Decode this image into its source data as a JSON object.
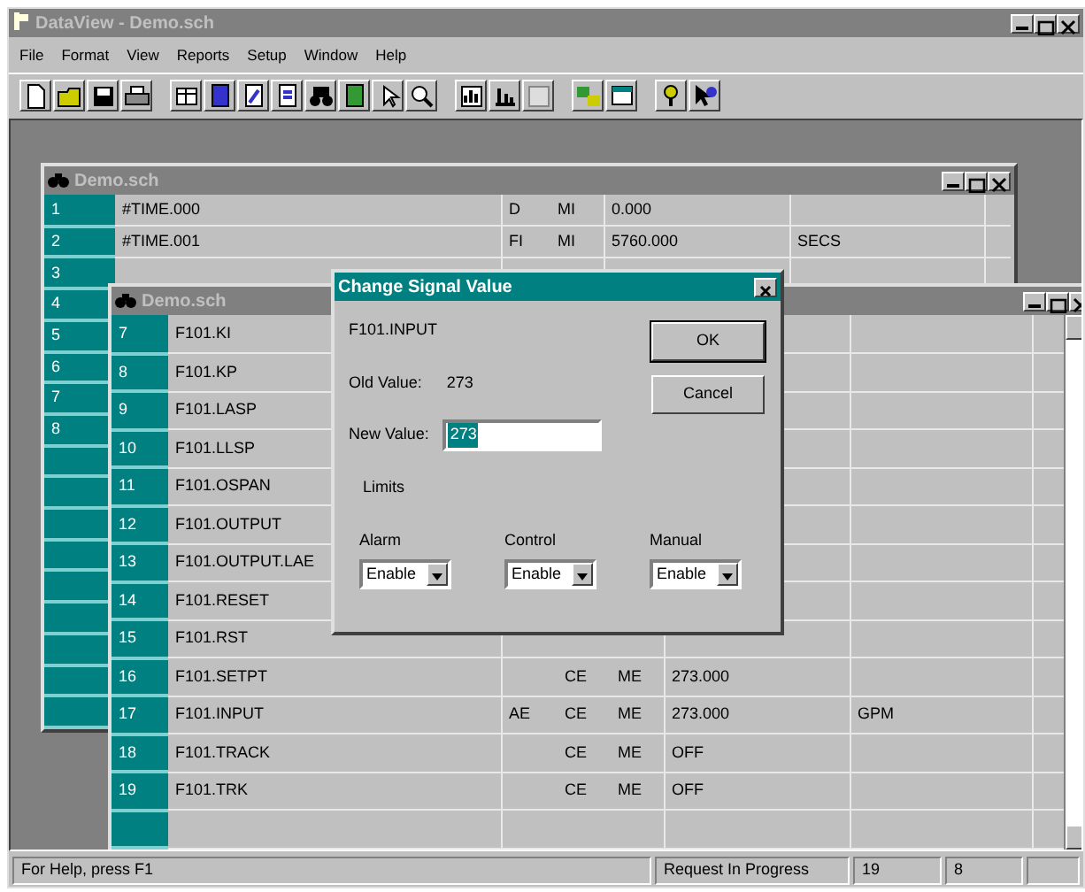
{
  "app": {
    "title": "DataView - Demo.sch",
    "active": false
  },
  "menu": [
    "File",
    "Format",
    "View",
    "Reports",
    "Setup",
    "Window",
    "Help"
  ],
  "windows": [
    {
      "title": "Demo.sch",
      "active": false,
      "rows": [
        {
          "number": "1",
          "name": "#TIME.000",
          "col_3": "D",
          "col_4": "MI",
          "value": "0.000"
        },
        {
          "number": "2",
          "name": "#TIME.001",
          "col_3": "FI",
          "col_4": "MI",
          "value": "5760.000",
          "units": "SECS"
        },
        {
          "number": "3"
        },
        {
          "number": "4"
        },
        {
          "number": "5"
        },
        {
          "number": "6"
        },
        {
          "number": "7"
        },
        {
          "number": "8"
        }
      ]
    },
    {
      "title": "Demo.sch",
      "active": false,
      "rows": [
        {
          "number": "7",
          "name": "F101.KI"
        },
        {
          "number": "8",
          "name": "F101.KP"
        },
        {
          "number": "9",
          "name": "F101.LASP"
        },
        {
          "number": "10",
          "name": "F101.LLSP"
        },
        {
          "number": "11",
          "name": "F101.OSPAN"
        },
        {
          "number": "12",
          "name": "F101.OUTPUT"
        },
        {
          "number": "13",
          "name": "F101.OUTPUT.LAE"
        },
        {
          "number": "14",
          "name": "F101.RESET"
        },
        {
          "number": "15",
          "name": "F101.RST"
        },
        {
          "number": "16",
          "name": "F101.SETPT",
          "col_4": "CE",
          "col_5": "ME",
          "value": "273.000"
        },
        {
          "number": "17",
          "name": "F101.INPUT",
          "col_3": "AE",
          "col_4": "CE",
          "col_5": "ME",
          "value": "273.000",
          "units": "GPM"
        },
        {
          "number": "18",
          "name": "F101.TRACK",
          "col_4": "CE",
          "col_5": "ME",
          "value": "OFF"
        },
        {
          "number": "19",
          "name": "F101.TRK",
          "col_4": "CE",
          "col_5": "ME",
          "value": "OFF"
        }
      ]
    }
  ],
  "dialog": {
    "title": "Change Signal Value",
    "active": true,
    "signal": "F101.INPUT",
    "old_value_label": "Old Value:",
    "old_value": "273",
    "new_value_label": "New Value:",
    "new_value": "273",
    "new_value_selected": true,
    "limits_label": "Limits",
    "limits": [
      {
        "label": "Alarm",
        "value": "Enable"
      },
      {
        "label": "Control",
        "value": "Enable"
      },
      {
        "label": "Manual",
        "value": "Enable"
      }
    ],
    "buttons": [
      {
        "label": "OK",
        "default": true
      },
      {
        "label": "Cancel",
        "default": false
      }
    ]
  },
  "status_bar": [
    "For Help, press F1",
    "Request In Progress",
    "19",
    "8"
  ]
}
